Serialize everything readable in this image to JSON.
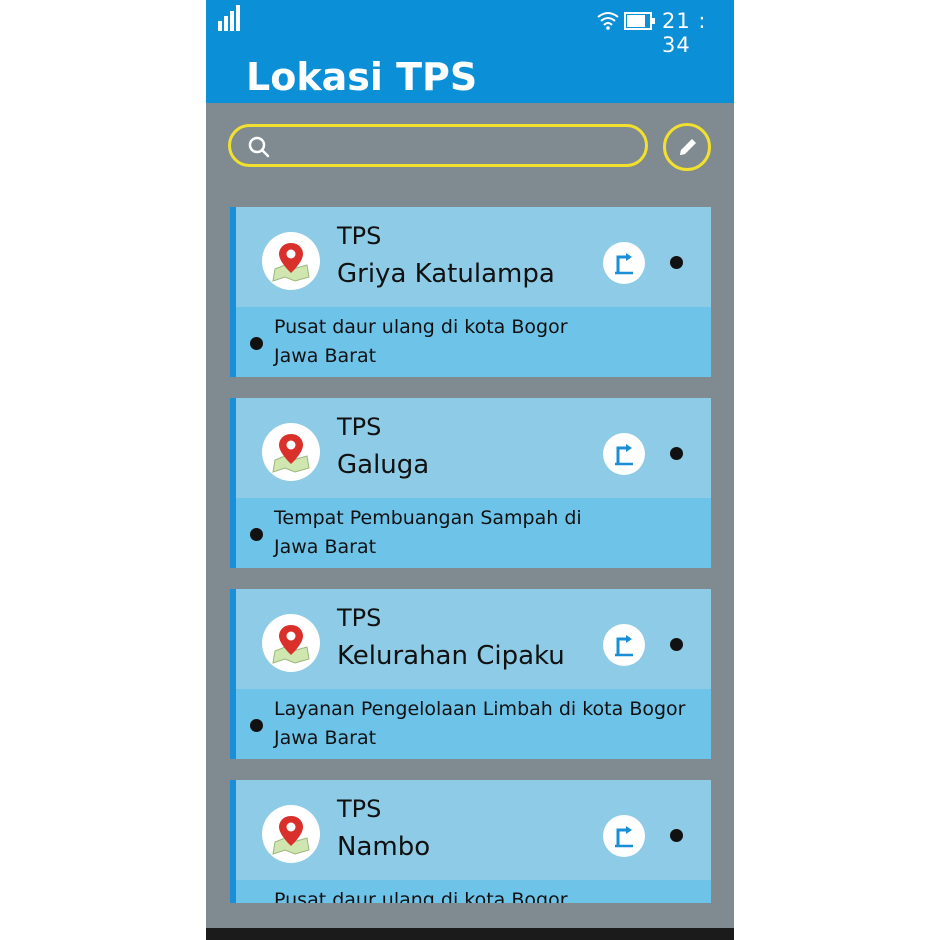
{
  "status": {
    "time": "21 : 34"
  },
  "header": {
    "title": "Lokasi TPS"
  },
  "search": {
    "placeholder": ""
  },
  "items": [
    {
      "label": "TPS",
      "name": "Griya Katulampa",
      "desc1": "Pusat daur ulang di kota Bogor",
      "desc2": "Jawa Barat"
    },
    {
      "label": "TPS",
      "name": "Galuga",
      "desc1": "Tempat Pembuangan Sampah di",
      "desc2": "Jawa Barat"
    },
    {
      "label": "TPS",
      "name": "Kelurahan Cipaku",
      "desc1": "Layanan Pengelolaan Limbah di kota Bogor",
      "desc2": "Jawa Barat"
    },
    {
      "label": "TPS",
      "name": "Nambo",
      "desc1": "Pusat daur ulang di kota Bogor",
      "desc2": ""
    }
  ],
  "colors": {
    "appbar": "#0b8fd6",
    "background": "#7f8a91",
    "accent_yellow": "#f2e02e",
    "card_top": "#8dcbe6",
    "card_bottom": "#6ec3e9"
  },
  "icons": [
    "signal-icon",
    "wifi-icon",
    "battery-icon",
    "search-icon",
    "pencil-icon",
    "map-pin-icon",
    "route-icon"
  ]
}
